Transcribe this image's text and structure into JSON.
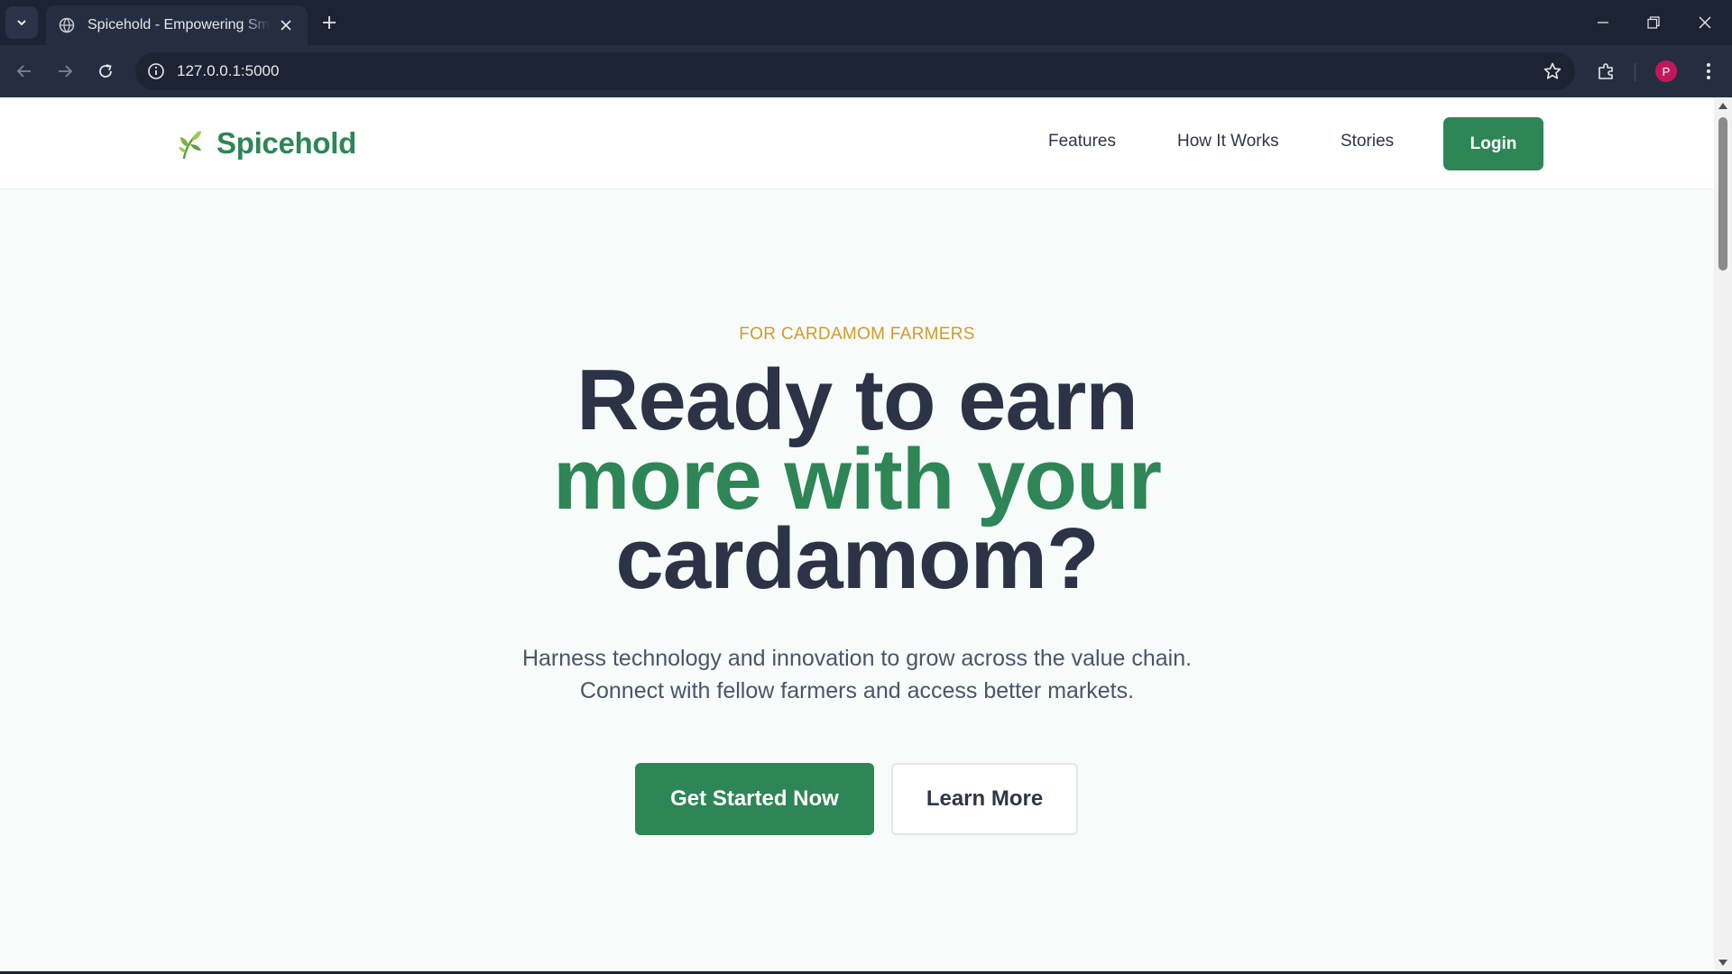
{
  "browser": {
    "tab_title": "Spicehold - Empowering Small Farmers",
    "url": "127.0.0.1:5000",
    "profile_initial": "P",
    "profile_color": "#c2185b"
  },
  "header": {
    "brand": "Spicehold",
    "nav": {
      "features": "Features",
      "how_it_works": "How It Works",
      "stories": "Stories"
    },
    "login_label": "Login"
  },
  "hero": {
    "eyebrow": "FOR CARDAMOM FARMERS",
    "headline_line1": "Ready to earn",
    "headline_line2": "more with your",
    "headline_line3": "cardamom?",
    "subtext_line1": "Harness technology and innovation to grow across the value chain.",
    "subtext_line2": "Connect with fellow farmers and access better markets.",
    "primary_cta": "Get Started Now",
    "secondary_cta": "Learn More"
  },
  "colors": {
    "brand_green": "#2e8556",
    "accent_gold": "#d49a2a",
    "heading_dark": "#2d3346"
  },
  "icons": {
    "logo": "leaf-sprig-icon",
    "tab_favicon": "globe-icon"
  }
}
